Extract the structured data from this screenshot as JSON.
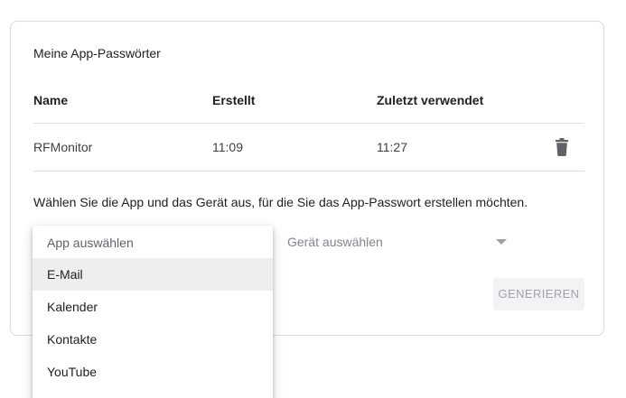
{
  "card": {
    "title": "Meine App-Passwörter"
  },
  "table": {
    "headers": {
      "name": "Name",
      "created": "Erstellt",
      "last_used": "Zuletzt verwendet"
    },
    "rows": [
      {
        "name": "RFMonitor",
        "created": "11:09",
        "last_used": "11:27",
        "action_icon": "trash-icon"
      }
    ]
  },
  "instruction": "Wählen Sie die App und das Gerät aus, für die Sie das App-Passwort erstellen möchten.",
  "app_select": {
    "placeholder": "App auswählen",
    "options": [
      "E-Mail",
      "Kalender",
      "Kontakte",
      "YouTube"
    ],
    "highlighted": "E-Mail"
  },
  "device_select": {
    "placeholder": "Gerät auswählen",
    "icon": "chevron-down-icon"
  },
  "generate_button": {
    "label": "GENERIEREN"
  },
  "colors": {
    "border": "#dadce0",
    "disabled_button_bg": "#f1f3f4",
    "disabled_button_text": "#a0a4a8",
    "highlight": "#eeeeee"
  }
}
